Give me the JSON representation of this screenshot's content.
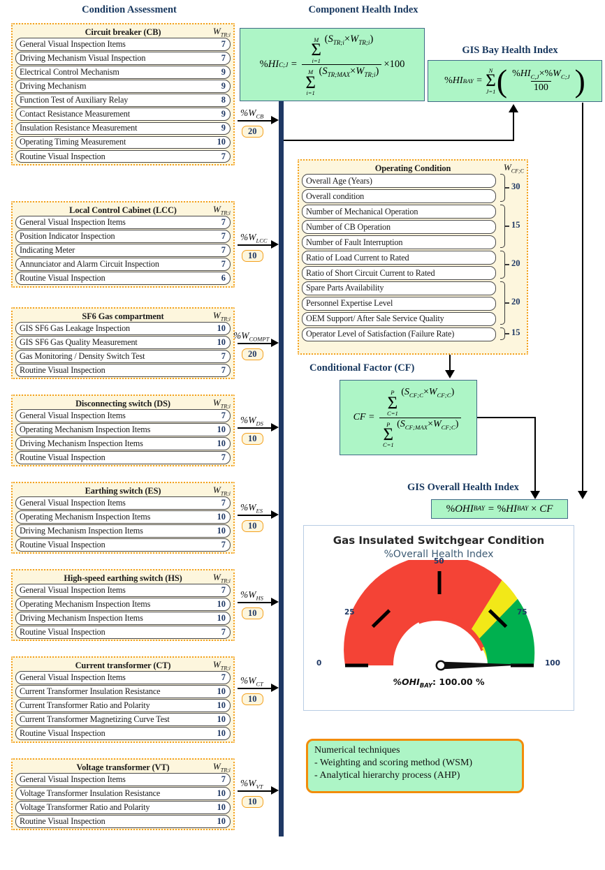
{
  "headings": {
    "condition_assessment": "Condition Assessment",
    "component_health_index": "Component Health Index",
    "gis_bay_health_index": "GIS Bay Health Index",
    "conditional_factor": "Conditional Factor (CF)",
    "gis_overall_health_index": "GIS Overall Health Index"
  },
  "weight_symbol_tr": "W",
  "weight_symbol_tr_sub": "TR;i",
  "weight_symbol_cf": "W",
  "weight_symbol_cf_sub": "CF;C",
  "panels": [
    {
      "id": "circuit-breaker",
      "title": "Circuit breaker (CB)",
      "rows": [
        {
          "label": "General Visual Inspection Items",
          "value": "7"
        },
        {
          "label": "Driving Mechanism Visual Inspection",
          "value": "7"
        },
        {
          "label": "Electrical Control Mechanism",
          "value": "9"
        },
        {
          "label": "Driving Mechanism",
          "value": "9"
        },
        {
          "label": "Function Test of Auxiliary Relay",
          "value": "8"
        },
        {
          "label": "Contact Resistance Measurement",
          "value": "9"
        },
        {
          "label": "Insulation Resistance Measurement",
          "value": "9"
        },
        {
          "label": "Operating Timing Measurement",
          "value": "10"
        },
        {
          "label": "Routine Visual Inspection",
          "value": "7"
        }
      ]
    },
    {
      "id": "local-control-cabinet",
      "title": "Local Control Cabinet (LCC)",
      "rows": [
        {
          "label": "General Visual Inspection Items",
          "value": "7"
        },
        {
          "label": "Position Indicator Inspection",
          "value": "7"
        },
        {
          "label": "Indicating Meter",
          "value": "7"
        },
        {
          "label": "Annunciator and Alarm Circuit Inspection",
          "value": "7"
        },
        {
          "label": "Routine Visual Inspection",
          "value": "6"
        }
      ]
    },
    {
      "id": "sf6-gas-compartment",
      "title": "SF6 Gas compartment",
      "rows": [
        {
          "label": "GIS SF6 Gas Leakage Inspection",
          "value": "10"
        },
        {
          "label": "GIS SF6 Gas Quality Measurement",
          "value": "10"
        },
        {
          "label": "Gas Monitoring / Density Switch Test",
          "value": "7"
        },
        {
          "label": "Routine Visual Inspection",
          "value": "7"
        }
      ]
    },
    {
      "id": "disconnecting-switch",
      "title": "Disconnecting switch (DS)",
      "rows": [
        {
          "label": "General Visual Inspection Items",
          "value": "7"
        },
        {
          "label": "Operating Mechanism Inspection Items",
          "value": "10"
        },
        {
          "label": "Driving Mechanism Inspection Items",
          "value": "10"
        },
        {
          "label": "Routine Visual Inspection",
          "value": "7"
        }
      ]
    },
    {
      "id": "earthing-switch",
      "title": "Earthing switch (ES)",
      "rows": [
        {
          "label": "General Visual Inspection Items",
          "value": "7"
        },
        {
          "label": "Operating Mechanism Inspection Items",
          "value": "10"
        },
        {
          "label": "Driving Mechanism Inspection Items",
          "value": "10"
        },
        {
          "label": "Routine Visual Inspection",
          "value": "7"
        }
      ]
    },
    {
      "id": "high-speed-earthing-switch",
      "title": "High-speed earthing switch (HS)",
      "rows": [
        {
          "label": "General Visual Inspection Items",
          "value": "7"
        },
        {
          "label": "Operating Mechanism Inspection Items",
          "value": "10"
        },
        {
          "label": "Driving Mechanism Inspection Items",
          "value": "10"
        },
        {
          "label": "Routine Visual Inspection",
          "value": "7"
        }
      ]
    },
    {
      "id": "current-transformer",
      "title": "Current transformer (CT)",
      "rows": [
        {
          "label": "General Visual Inspection Items",
          "value": "7"
        },
        {
          "label": "Current Transformer Insulation Resistance",
          "value": "10"
        },
        {
          "label": "Current Transformer Ratio and Polarity",
          "value": "10"
        },
        {
          "label": "Current Transformer Magnetizing Curve Test",
          "value": "10"
        },
        {
          "label": "Routine Visual Inspection",
          "value": "10"
        }
      ]
    },
    {
      "id": "voltage-transformer",
      "title": "Voltage transformer (VT)",
      "rows": [
        {
          "label": "General Visual Inspection Items",
          "value": "7"
        },
        {
          "label": "Voltage Transformer Insulation Resistance",
          "value": "10"
        },
        {
          "label": "Voltage Transformer Ratio and Polarity",
          "value": "10"
        },
        {
          "label": "Routine Visual Inspection",
          "value": "10"
        }
      ]
    }
  ],
  "weight_arrows": [
    {
      "id": "cb",
      "symbol": "%W",
      "sub": "CB",
      "value": "20"
    },
    {
      "id": "lcc",
      "symbol": "%W",
      "sub": "LCC",
      "value": "10"
    },
    {
      "id": "compt",
      "symbol": "%W",
      "sub": "COMPT",
      "value": "20"
    },
    {
      "id": "ds",
      "symbol": "%W",
      "sub": "DS",
      "value": "10"
    },
    {
      "id": "es",
      "symbol": "%W",
      "sub": "ES",
      "value": "10"
    },
    {
      "id": "hs",
      "symbol": "%W",
      "sub": "HS",
      "value": "10"
    },
    {
      "id": "ct",
      "symbol": "%W",
      "sub": "CT",
      "value": "10"
    },
    {
      "id": "vt",
      "symbol": "%W",
      "sub": "VT",
      "value": "10"
    }
  ],
  "operating_condition": {
    "title": "Operating Condition",
    "rows": [
      "Overall Age (Years)",
      "Overall condition",
      "Number of Mechanical Operation",
      "Number of CB Operation",
      "Number of Fault Interruption",
      "Ratio of Load Current to Rated",
      "Ratio of Short Circuit Current to Rated",
      "Spare Parts Availability",
      "Personnel Expertise Level",
      "OEM Support/ After Sale Service Quality",
      "Operator Level of Satisfaction (Failure Rate)"
    ],
    "group_weights": [
      "30",
      "15",
      "20",
      "20",
      "15"
    ]
  },
  "gauge": {
    "title": "Gas Insulated Switchgear Condition",
    "subtitle": "%Overall Health Index",
    "tick_labels": [
      "0",
      "25",
      "50",
      "75",
      "100"
    ],
    "value_label_prefix": "%OHI",
    "value_label_sub": "BAY",
    "value_label_text": ": 100.00 %"
  },
  "chart_data": {
    "type": "gauge",
    "title": "Gas Insulated Switchgear Condition",
    "subtitle": "%Overall Health Index",
    "value": 100.0,
    "unit": "%",
    "min": 0,
    "max": 100,
    "ticks": [
      0,
      25,
      50,
      75,
      100
    ],
    "bands": [
      {
        "from": 0,
        "to": 65,
        "color": "#F44336",
        "label": "poor"
      },
      {
        "from": 65,
        "to": 85,
        "color": "#F2E818",
        "label": "fair"
      },
      {
        "from": 85,
        "to": 100,
        "color": "#00B04F",
        "label": "good"
      }
    ],
    "needle_value": 100,
    "value_text": "%OHIBAY : 100.00 %"
  },
  "note": {
    "line1": "Numerical techniques",
    "line2": "- Weighting and scoring method (WSM)",
    "line3": "- Analytical hierarchy process (AHP)"
  },
  "colors": {
    "heading": "#17375E",
    "panel_bg": "#FDF6DD",
    "panel_border": "#F4A11E",
    "formula_bg": "#ADF5C6",
    "formula_border": "#3F6A86",
    "spine": "#1F3864",
    "gauge_red": "#F44336",
    "gauge_yellow": "#F2E818",
    "gauge_green": "#00B04F"
  }
}
